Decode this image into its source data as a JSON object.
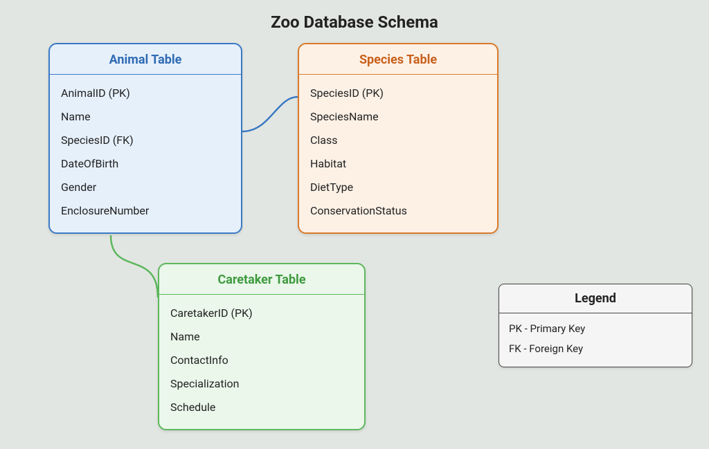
{
  "title": "Zoo Database Schema",
  "tables": {
    "animal": {
      "title": "Animal Table",
      "fields": [
        "AnimalID (PK)",
        "Name",
        "SpeciesID (FK)",
        "DateOfBirth",
        "Gender",
        "EnclosureNumber"
      ]
    },
    "species": {
      "title": "Species Table",
      "fields": [
        "SpeciesID (PK)",
        "SpeciesName",
        "Class",
        "Habitat",
        "DietType",
        "ConservationStatus"
      ]
    },
    "caretaker": {
      "title": "Caretaker Table",
      "fields": [
        "CaretakerID (PK)",
        "Name",
        "ContactInfo",
        "Specialization",
        "Schedule"
      ]
    }
  },
  "legend": {
    "title": "Legend",
    "items": [
      "PK - Primary Key",
      "FK - Foreign Key"
    ]
  },
  "colors": {
    "animal_border": "#3a79c4",
    "species_border": "#d97a2b",
    "caretaker_border": "#5cb85c"
  }
}
